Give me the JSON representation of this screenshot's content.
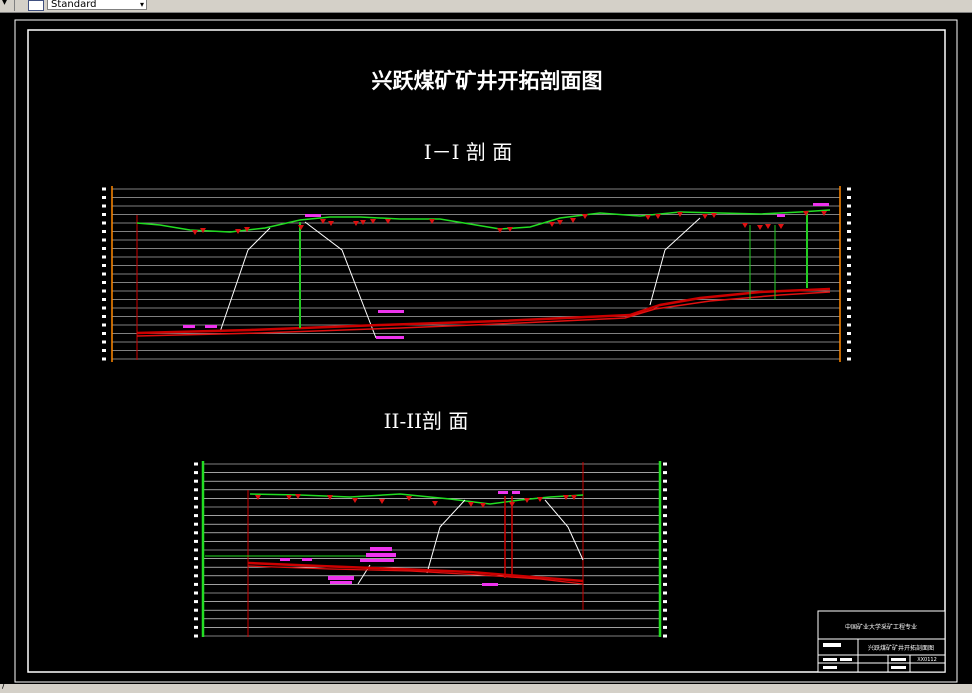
{
  "toolbar": {
    "style_value": "Standard",
    "dropdown_glyph": "▾",
    "left_glyph": "▾"
  },
  "drawing": {
    "title": "兴跃煤矿矿井开拓剖面图",
    "section1_label": "I－I 剖  面",
    "section2_label": "II-II剖  面",
    "colors": {
      "background": "#000000",
      "frame": "#ffffff",
      "terrain": "#22dd22",
      "seam": "#cc0000",
      "shaft": "#22cc22",
      "magenta": "#ee33ee",
      "grid": "#ffffff"
    }
  },
  "title_block": {
    "school": "中国矿业大学采矿工程专业",
    "drawing_name": "兴跃煤矿矿井开拓剖面图",
    "code": "XX0112"
  },
  "status": {
    "glyph": "/"
  }
}
